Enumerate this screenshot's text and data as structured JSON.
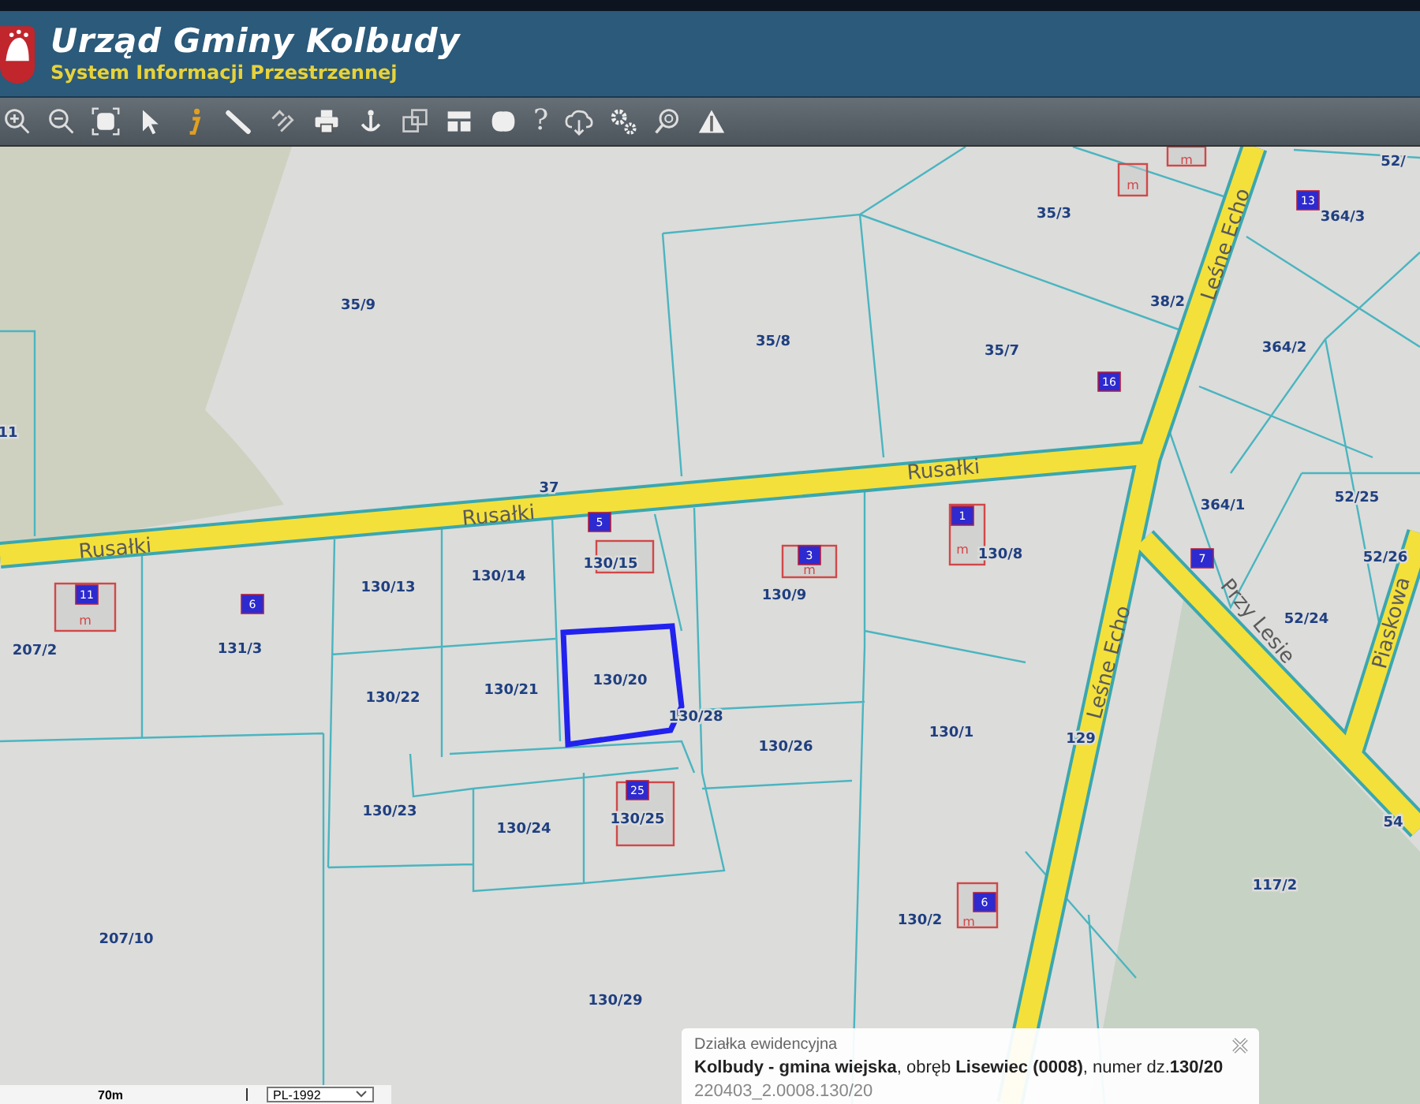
{
  "header": {
    "title": "Urząd Gminy Kolbudy",
    "subtitle": "System Informacji Przestrzennej"
  },
  "toolbar": {
    "tools": [
      {
        "kind": "zoom-in"
      },
      {
        "kind": "zoom-out"
      },
      {
        "kind": "extent"
      },
      {
        "kind": "pointer"
      },
      {
        "kind": "info"
      },
      {
        "kind": "measure"
      },
      {
        "kind": "link"
      },
      {
        "kind": "print"
      },
      {
        "kind": "anchor"
      },
      {
        "kind": "layers"
      },
      {
        "kind": "layout"
      },
      {
        "kind": "shape"
      },
      {
        "kind": "help",
        "label": "?"
      },
      {
        "kind": "cloud"
      },
      {
        "kind": "settings"
      },
      {
        "kind": "search"
      },
      {
        "kind": "warning"
      }
    ]
  },
  "map": {
    "parcel_labels": [
      "52/",
      "35/3",
      "364/3",
      "35/9",
      "35/8",
      "35/7",
      "38/2",
      "364/2",
      "11",
      "364/1",
      "52/25",
      "52/26",
      "130/13",
      "130/14",
      "130/15",
      "130/9",
      "130/8",
      "52/24",
      "207/2",
      "131/3",
      "130/22",
      "130/21",
      "130/20",
      "130/28",
      "130/26",
      "130/1",
      "130/23",
      "130/24",
      "130/25",
      "207/10",
      "130/2",
      "117/2",
      "130/29"
    ],
    "street_labels": [
      "Rusałki",
      "Rusałki",
      "Rusałki",
      "Leśne Echo",
      "Leśne Echo",
      "Przy Lesie",
      "Piaskowa"
    ],
    "road_numbers": [
      "37",
      "129",
      "54"
    ],
    "buildings": [
      {
        "number": "11",
        "use": "m"
      },
      {
        "number": "6"
      },
      {
        "number": "5"
      },
      {
        "number": "1",
        "use": "m"
      },
      {
        "number": "3",
        "use": "m"
      },
      {
        "number": "16"
      },
      {
        "number": "13"
      },
      {
        "number": "7"
      },
      {
        "number": "25"
      },
      {
        "number": "6",
        "use": "m"
      },
      {
        "use": "m"
      },
      {
        "use": "m"
      }
    ]
  },
  "scale": {
    "label": "70m"
  },
  "projection": {
    "value": "PL-1992"
  },
  "info_popup": {
    "title": "Działka ewidencyjna",
    "description": "**Kolbudy - gmina wiejska**, obręb **Lisewiec (0008)**, numer dz.**130/20**",
    "identifier": "220403_2.0008.130/20"
  }
}
